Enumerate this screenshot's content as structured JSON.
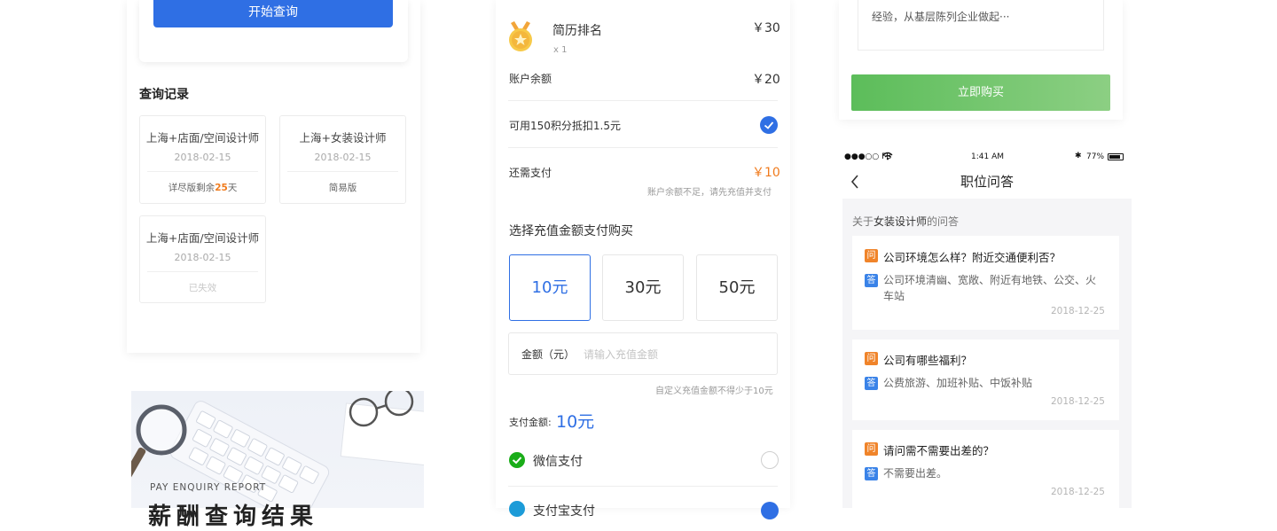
{
  "panel_query": {
    "start_button": "开始查询",
    "history_title": "查询记录",
    "records": [
      {
        "title": "上海+店面/空间设计师",
        "date": "2018-02-15",
        "foot_prefix": "详尽版剩余",
        "foot_highlight": "25",
        "foot_suffix": "天"
      },
      {
        "title": "上海+女装设计师",
        "date": "2018-02-15",
        "foot": "简易版"
      },
      {
        "title": "上海+店面/空间设计师",
        "date": "2018-02-15",
        "foot": "已失效"
      }
    ],
    "promo": {
      "subtitle": "PAY ENQUIRY REPORT",
      "title": "薪酬查询结果"
    }
  },
  "panel_pay": {
    "product_name": "简历排名",
    "product_qty": "x 1",
    "product_price": "￥30",
    "balance_label": "账户余额",
    "balance_value": "￥20",
    "points_label": "可用150积分抵扣1.5元",
    "due_label": "还需支付",
    "due_value": "￥10",
    "due_hint": "账户余额不足，请先充值并支付",
    "recharge_title": "选择充值金额支付购买",
    "amounts": [
      "10元",
      "30元",
      "50元"
    ],
    "amount_label": "金额（元）",
    "amount_placeholder": "请输入充值金额",
    "amount_hint": "自定义充值金额不得少于10元",
    "pay_total_label": "支付金额:",
    "pay_total_value": "10元",
    "method_wechat": "微信支付",
    "method_alipay": "支付宝支付",
    "colors": {
      "accent": "#2f6fe4",
      "orange": "#f07b1d",
      "wechat": "#1aad19"
    }
  },
  "panel_qa": {
    "desc_text": "经验，从基层陈列企业做起···",
    "buy_button": "立即购买",
    "status": {
      "carrier": "●●●○○ FB",
      "time": "1:41 AM",
      "battery": "77%"
    },
    "nav_title": "职位问答",
    "section_prefix": "关于",
    "section_job": "女装设计师",
    "section_suffix": "的问答",
    "q_badge": "问",
    "a_badge": "答",
    "items": [
      {
        "question": "公司环境怎么样？附近交通便利否？",
        "answer": "公司环境清幽、宽敞、附近有地铁、公交、火车站",
        "date": "2018-12-25"
      },
      {
        "question": "公司有哪些福利？",
        "answer": "公费旅游、加班补贴、中饭补贴",
        "date": "2018-12-25"
      },
      {
        "question": "请问需不需要出差的？",
        "answer": "不需要出差。",
        "date": "2018-12-25"
      }
    ]
  }
}
